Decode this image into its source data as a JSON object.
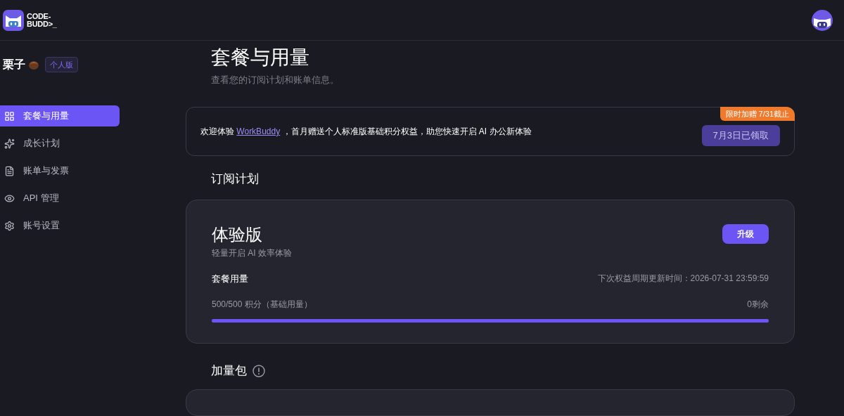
{
  "header": {
    "logo": [
      "CODE-",
      "BUDD>_"
    ]
  },
  "user": {
    "name": "栗子",
    "badge": "个人版"
  },
  "sidebar": {
    "items": [
      {
        "label": "套餐与用量",
        "selected": true
      },
      {
        "label": "成长计划",
        "selected": false
      },
      {
        "label": "账单与发票",
        "selected": false
      },
      {
        "label": "API 管理",
        "selected": false
      },
      {
        "label": "账号设置",
        "selected": false
      }
    ]
  },
  "page": {
    "title": "套餐与用量",
    "subtitle": "查看您的订阅计划和账单信息。"
  },
  "banner": {
    "text_before": "欢迎体验",
    "link": "WorkBuddy",
    "text_after": "，首月赠送个人标准版基础积分权益，助您快速开启 AI 办公新体验",
    "tag": "限时加赠 7/31截止",
    "button": "7月3日已领取",
    "disabled": true
  },
  "plan_section": {
    "heading": "订阅计划",
    "name": "体验版",
    "description": "轻量开启 AI 效率体验",
    "upgrade": "升级",
    "usage_label": "套餐用量",
    "renewal": "下次权益周期更新时间：2026-07-31 23:59:59",
    "usage": "500/500 积分（基础用量）",
    "remaining": "0剩余",
    "level": 1
  },
  "addon_section": {
    "heading": "加量包"
  }
}
